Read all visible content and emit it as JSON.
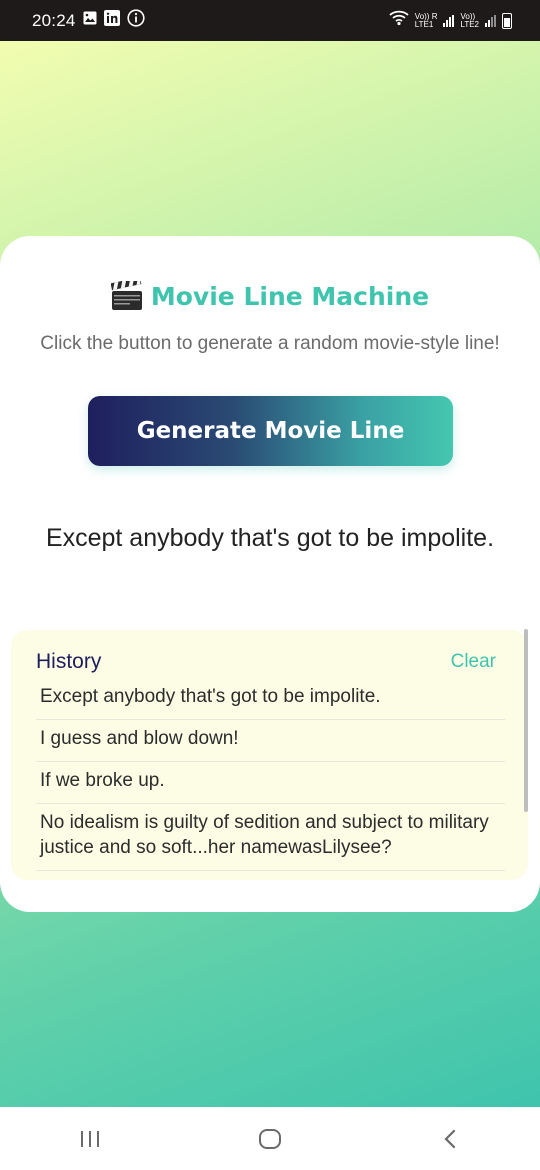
{
  "status_bar": {
    "time": "20:24",
    "sim1_top": "Vo)) R",
    "sim1_bottom": "LTE1",
    "sim2_top": "Vo))",
    "sim2_bottom": "LTE2",
    "icons": [
      "gallery-icon",
      "linkedin-icon",
      "info-icon",
      "wifi-icon",
      "signal-icon",
      "battery-icon"
    ]
  },
  "app": {
    "title": "Movie Line Machine",
    "title_icon": "clapperboard-icon",
    "subtitle": "Click the button to generate a random movie-style line!",
    "generate_button_label": "Generate Movie Line",
    "current_line": "Except anybody that's got to be impolite."
  },
  "history": {
    "title": "History",
    "clear_label": "Clear",
    "items": [
      "Except anybody that's got to be impolite.",
      "I guess and blow down!",
      "If we broke up.",
      "No idealism is guilty of sedition and subject to military justice and so soft...her namewasLilysee?"
    ]
  },
  "nav": {
    "icons": [
      "recent-apps-icon",
      "home-icon",
      "back-icon"
    ]
  },
  "colors": {
    "accent": "#3fc4ae",
    "dark": "#1f1f5e",
    "history_bg": "#fdfde6"
  }
}
